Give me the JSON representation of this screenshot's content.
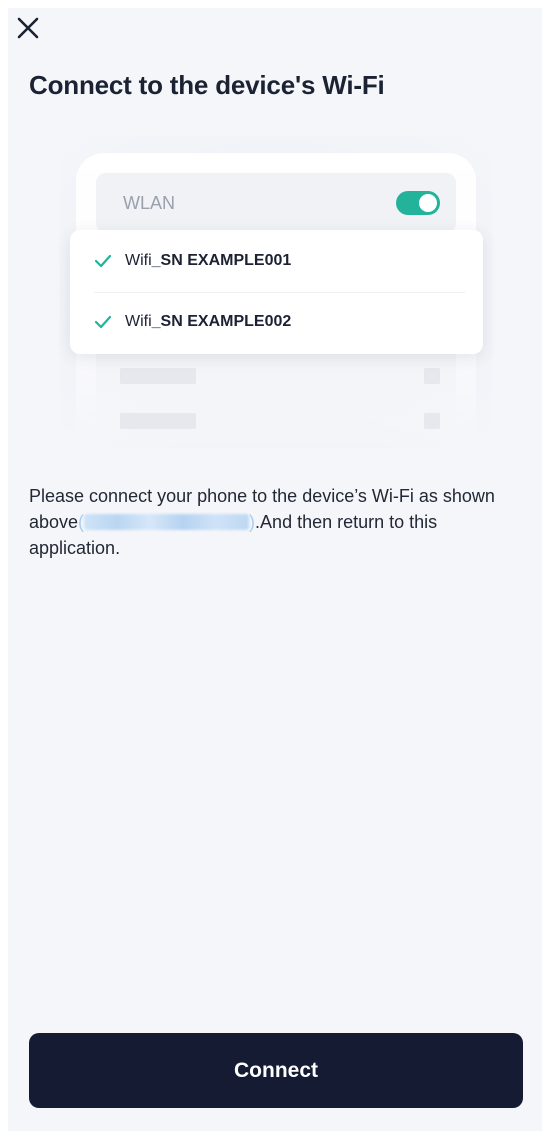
{
  "header": {
    "close_icon": "close-icon",
    "title": "Connect to the device's Wi-Fi"
  },
  "illustration": {
    "wlan_label": "WLAN",
    "toggle_on": true,
    "accent_color": "#22b39a",
    "networks": [
      {
        "prefix": "Wifi",
        "suffix": "_SN EXAMPLE001"
      },
      {
        "prefix": "Wifi",
        "suffix": "_SN EXAMPLE002"
      }
    ]
  },
  "instruction": {
    "text_before": "Please connect your phone to the device’s Wi-Fi as shown above",
    "paren_open": "(",
    "paren_close": ")",
    "text_after": ".And then return to this application."
  },
  "footer": {
    "connect_label": "Connect",
    "button_color": "#141b33"
  }
}
